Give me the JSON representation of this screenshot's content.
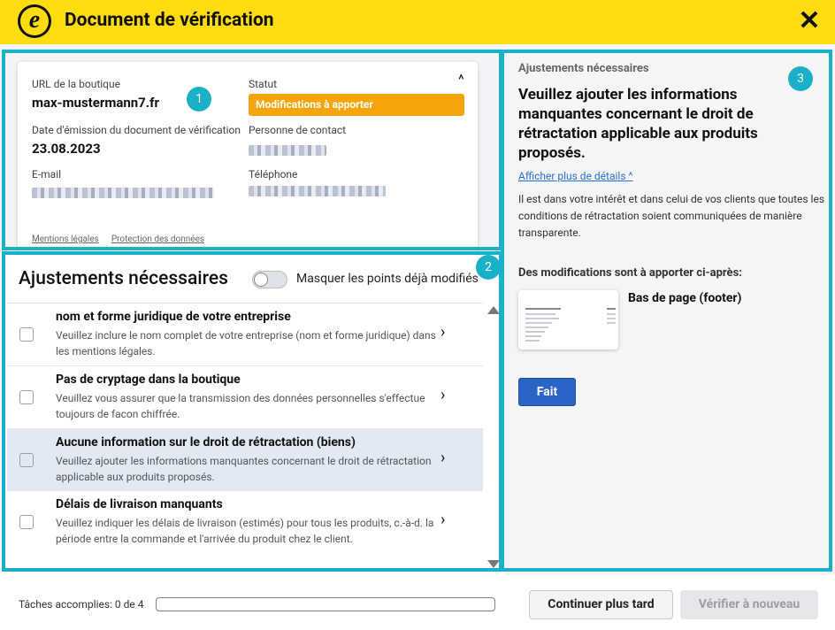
{
  "header": {
    "title": "Document de vérification",
    "logo_letter": "e",
    "close_icon": "close-icon"
  },
  "annotations": {
    "n1": "1",
    "n2": "2",
    "n3": "3",
    "accent": "#1ab0c8"
  },
  "shop_card": {
    "url_label": "URL de la boutique",
    "url_value": "max-mustermann7.fr",
    "status_label": "Statut",
    "status_value": "Modifications à apporter",
    "status_color": "#f5a409",
    "date_label": "Date d'émission du document de vérification",
    "date_value": "23.08.2023",
    "contact_label": "Personne de contact",
    "email_label": "E-mail",
    "phone_label": "Téléphone",
    "links": [
      "Mentions légales",
      "Protection des données"
    ]
  },
  "list": {
    "title": "Ajustements nécessaires",
    "toggle_label": "Masquer les points déjà modifiés",
    "toggle_on": false,
    "items": [
      {
        "title": "nom et forme juridique de votre entreprise",
        "desc": "Veuillez inclure le nom complet de votre entreprise (nom et forme juridique) dans les mentions légales.",
        "active": false
      },
      {
        "title": "Pas de cryptage dans la boutique",
        "desc": "Veuillez vous assurer que la transmission des données personnelles s'effectue toujours de facon chiffrée.",
        "active": false
      },
      {
        "title": "Aucune information sur le droit de rétractation (biens)",
        "desc": "Veuillez ajouter les informations manquantes concernant le droit de rétractation applicable aux produits proposés.",
        "active": true
      },
      {
        "title": "Délais de livraison manquants",
        "desc": "Veuillez indiquer les délais de livraison (estimés) pour tous les produits, c.-à-d. la période entre la commande et l'arrivée du produit chez le client.",
        "active": false
      }
    ]
  },
  "detail": {
    "subtitle": "Ajustements nécessaires",
    "heading": "Veuillez ajouter les informations manquantes concernant le droit de rétractation applicable aux produits proposés.",
    "more_link": "Afficher plus de détails",
    "text": "Il est dans votre intérêt et dans celui de vos clients que toutes les conditions de rétractation soient communiquées de manière transparente.",
    "mods_title": "Des modifications sont à apporter ci-après:",
    "location_label": "Bas de page (footer)",
    "done_button": "Fait"
  },
  "footer": {
    "tasks_label": "Tâches accomplies: 0 de 4",
    "progress": 0,
    "later_button": "Continuer plus tard",
    "verify_button": "Vérifier à nouveau"
  }
}
